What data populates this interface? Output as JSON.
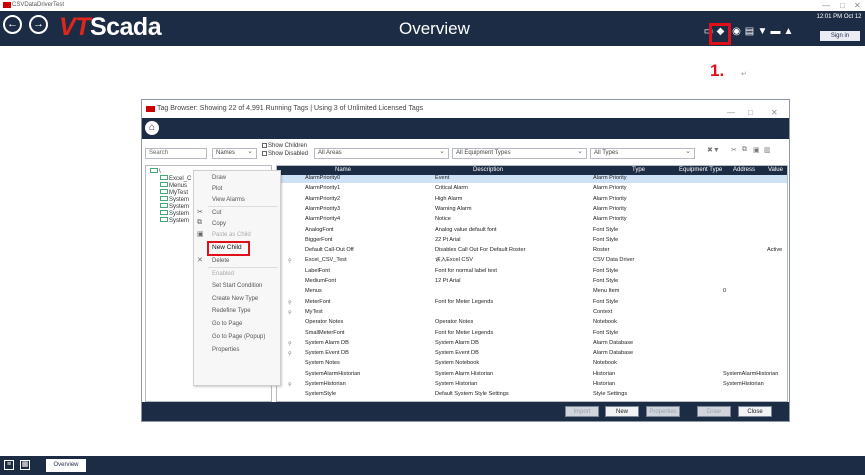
{
  "window_title": "CSVDataDriverTest",
  "window_controls": {
    "min": "—",
    "max": "□",
    "close": "✕"
  },
  "app": {
    "logo_prefix": "VT",
    "logo_suffix": "Scada",
    "page_title": "Overview",
    "clock": "12:01 PM Oct 12",
    "sign_in": "Sign in"
  },
  "icons": {
    "back": "back-arrow-icon",
    "forward": "forward-arrow-icon",
    "toolbar": [
      "display-icon",
      "tag-icon",
      "camera-icon",
      "report-icon",
      "filter-icon",
      "print-icon",
      "bell-icon"
    ]
  },
  "annotation": {
    "step": "1.",
    "return_mark": "↵"
  },
  "dialog": {
    "title": "Tag Browser: Showing 22 of 4,991 Running Tags | Using 3 of Unlimited Licensed Tags",
    "search_placeholder": "Search",
    "name_filter": "Names",
    "show_children": "Show Children",
    "show_disabled": "Show Disabled",
    "area_filter": "All Areas",
    "equipment_filter": "All Equipment Types",
    "type_filter": "All Types",
    "tree": [
      {
        "label": "\\"
      },
      {
        "label": "Excel_C"
      },
      {
        "label": "Menus"
      },
      {
        "label": "MyTest"
      },
      {
        "label": "System"
      },
      {
        "label": "System"
      },
      {
        "label": "System"
      },
      {
        "label": "System"
      }
    ],
    "columns": {
      "name": "Name",
      "description": "Description",
      "type": "Type",
      "equipment_type": "Equipment Type",
      "address": "Address",
      "value": "Value"
    },
    "rows": [
      {
        "name": "AlarmPriority0",
        "description": "Event",
        "type": "Alarm Priority",
        "address": "",
        "value": ""
      },
      {
        "name": "AlarmPriority1",
        "description": "Critical Alarm",
        "type": "Alarm Priority",
        "address": "",
        "value": ""
      },
      {
        "name": "AlarmPriority2",
        "description": "High Alarm",
        "type": "Alarm Priority",
        "address": "",
        "value": ""
      },
      {
        "name": "AlarmPriority3",
        "description": "Warning Alarm",
        "type": "Alarm Priority",
        "address": "",
        "value": ""
      },
      {
        "name": "AlarmPriority4",
        "description": "Notice",
        "type": "Alarm Priority",
        "address": "",
        "value": ""
      },
      {
        "name": "AnalogFont",
        "description": "Analog value default font",
        "type": "Font Style",
        "address": "",
        "value": ""
      },
      {
        "name": "BiggerFont",
        "description": "22 Pt Arial",
        "type": "Font Style",
        "address": "",
        "value": ""
      },
      {
        "name": "Default Call-Out Off",
        "description": "Disables Call Out For Default Roster",
        "type": "Roster",
        "address": "",
        "value": "Active"
      },
      {
        "name": "Excel_CSV_Test",
        "description": "读入Excel CSV",
        "type": "CSV Data Driver",
        "address": "",
        "value": ""
      },
      {
        "name": "LabelFont",
        "description": "Font for normal label text",
        "type": "Font Style",
        "address": "",
        "value": ""
      },
      {
        "name": "MediumFont",
        "description": "12 Pt Arial",
        "type": "Font Style",
        "address": "",
        "value": ""
      },
      {
        "name": "Menus",
        "description": "",
        "type": "Menu Item",
        "address": "0",
        "value": ""
      },
      {
        "name": "MeterFont",
        "description": "Font for Meter Legends",
        "type": "Font Style",
        "address": "",
        "value": ""
      },
      {
        "name": "MyTest",
        "description": "",
        "type": "Context",
        "address": "",
        "value": ""
      },
      {
        "name": "Operator Notes",
        "description": "Operator Notes",
        "type": "Notebook",
        "address": "",
        "value": ""
      },
      {
        "name": "SmallMeterFont",
        "description": "Font for Meter Legends",
        "type": "Font Style",
        "address": "",
        "value": ""
      },
      {
        "name": "System Alarm DB",
        "description": "System Alarm DB",
        "type": "Alarm Database",
        "address": "",
        "value": ""
      },
      {
        "name": "System Event DB",
        "description": "System Event DB",
        "type": "Alarm Database",
        "address": "",
        "value": ""
      },
      {
        "name": "System Notes",
        "description": "System Notebook",
        "type": "Notebook",
        "address": "",
        "value": ""
      },
      {
        "name": "SystemAlarmHistorian",
        "description": "System Alarm Historian",
        "type": "Historian",
        "address": "SystemAlarmHistorian",
        "value": ""
      },
      {
        "name": "SystemHistorian",
        "description": "System Historian",
        "type": "Historian",
        "address": "SystemHistorian",
        "value": ""
      },
      {
        "name": "SystemStyle",
        "description": "Default System Style Settings",
        "type": "Style Settings",
        "address": "",
        "value": ""
      }
    ],
    "context_menu": [
      {
        "label": "Draw",
        "enabled": true
      },
      {
        "label": "Plot",
        "enabled": true
      },
      {
        "label": "View Alarms",
        "enabled": true
      },
      {
        "label": "Cut",
        "enabled": true
      },
      {
        "label": "Copy",
        "enabled": true
      },
      {
        "label": "Paste as Child",
        "enabled": false
      },
      {
        "label": "New Child",
        "enabled": true
      },
      {
        "label": "Delete",
        "enabled": true
      },
      {
        "label": "Enabled",
        "enabled": false
      },
      {
        "label": "Set Start Condition",
        "enabled": true
      },
      {
        "label": "Create New Type",
        "enabled": true
      },
      {
        "label": "Redefine Type",
        "enabled": true
      },
      {
        "label": "Go to Page",
        "enabled": true
      },
      {
        "label": "Go to Page (Popup)",
        "enabled": true
      },
      {
        "label": "Properties",
        "enabled": true
      }
    ],
    "buttons": {
      "import": "Import",
      "new": "New",
      "properties": "Properties",
      "draw": "Draw",
      "close": "Close"
    }
  },
  "status": {
    "tab": "Overview"
  },
  "colors": {
    "navy": "#1d2c45",
    "accent_red": "#e0101a",
    "selected_row": "#cfe2f5"
  }
}
